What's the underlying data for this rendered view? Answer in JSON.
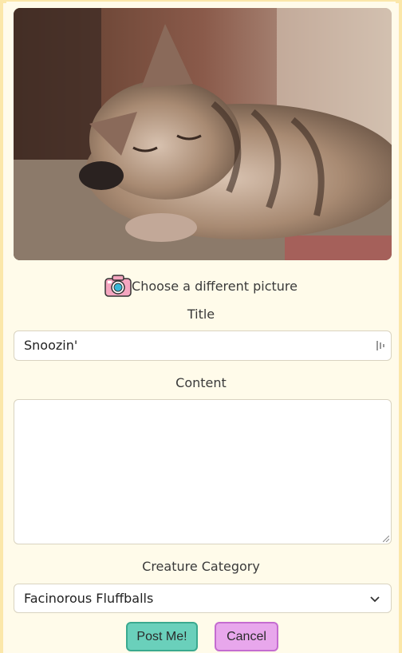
{
  "upload": {
    "choose_label": "Choose a different picture",
    "camera_icon": "camera-icon"
  },
  "form": {
    "title_label": "Title",
    "title_value": "Snoozin'",
    "content_label": "Content",
    "content_value": "",
    "category_label": "Creature Category",
    "category_value": "Facinorous Fluffballs"
  },
  "actions": {
    "post_label": "Post Me!",
    "cancel_label": "Cancel"
  },
  "colors": {
    "page_bg": "#fffbea",
    "post_button": "#6ad0bb",
    "cancel_button": "#e8a7ec"
  }
}
